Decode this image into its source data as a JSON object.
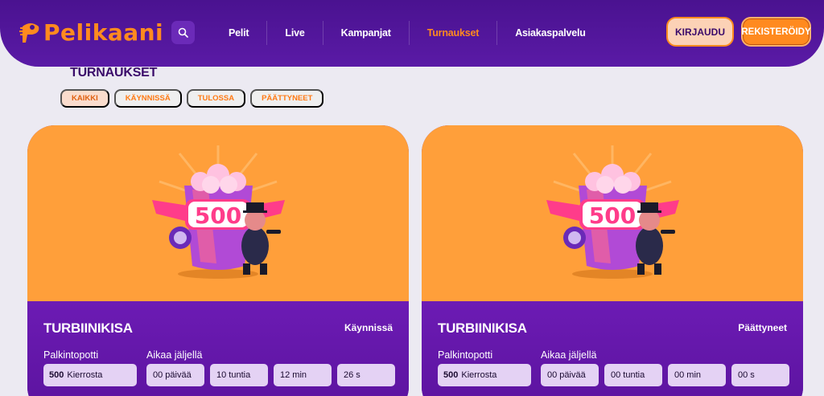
{
  "header": {
    "logo_text": "Pelikaani",
    "nav": [
      "Pelit",
      "Live",
      "Kampanjat",
      "Turnaukset",
      "Asiakaspalvelu"
    ],
    "active_nav": "Turnaukset",
    "login_label": "KIRJAUDU",
    "register_label": "REKISTERÖIDY",
    "accent_color": "#ff8a1f",
    "header_color": "#4a1290"
  },
  "page": {
    "title": "TURNAUKSET",
    "filters": [
      "KAIKKI",
      "KÄYNNISSÄ",
      "TULOSSA",
      "PÄÄTTYNEET"
    ],
    "active_filter": "KAIKKI"
  },
  "cards": [
    {
      "image_label": "500",
      "title": "TURBIINIKISA",
      "status": "Käynnissä",
      "prize_label": "Palkintopotti",
      "prize_amount": "500",
      "prize_unit": "Kierrosta",
      "time_label": "Aikaa jäljellä",
      "time": [
        "00 päivää",
        "10 tuntia",
        "12 min",
        "26 s"
      ]
    },
    {
      "image_label": "500",
      "title": "TURBIINIKISA",
      "status": "Päättyneet",
      "prize_label": "Palkintopotti",
      "prize_amount": "500",
      "prize_unit": "Kierrosta",
      "time_label": "Aikaa jäljellä",
      "time": [
        "00 päivää",
        "00 tuntia",
        "00 min",
        "00 s"
      ]
    }
  ]
}
